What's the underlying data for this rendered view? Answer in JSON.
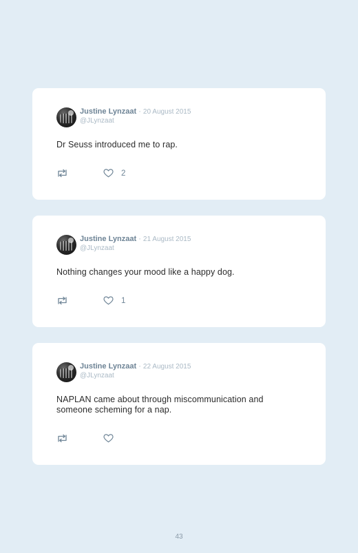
{
  "tweets": [
    {
      "name": "Justine Lynzaat",
      "separator": "·",
      "date": "20 August 2015",
      "handle": "@JLynzaat",
      "text": "Dr Seuss introduced me to rap.",
      "likes": "2"
    },
    {
      "name": "Justine Lynzaat",
      "separator": "·",
      "date": "21 August 2015",
      "handle": "@JLynzaat",
      "text": "Nothing changes your mood like a happy dog.",
      "likes": "1"
    },
    {
      "name": "Justine Lynzaat",
      "separator": "·",
      "date": "22 August 2015",
      "handle": "@JLynzaat",
      "text": "NAPLAN came about through miscommunication and someone scheming for a nap.",
      "likes": ""
    }
  ],
  "icons": {
    "retweet": "retweet-icon",
    "like": "heart-icon"
  },
  "colors": {
    "background": "#e2edf5",
    "card": "#ffffff",
    "name": "#6e8496",
    "muted": "#aab9c5"
  },
  "page_number": "43"
}
